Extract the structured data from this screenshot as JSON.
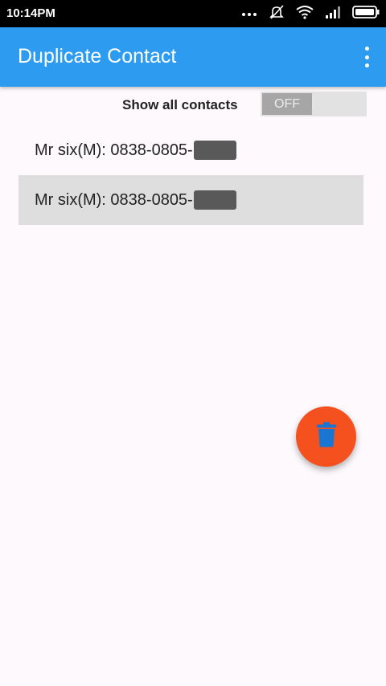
{
  "status_bar": {
    "time": "10:14PM",
    "icons": [
      "dots-icon",
      "muted-icon",
      "wifi-icon",
      "signal-icon",
      "battery-icon"
    ]
  },
  "app_bar": {
    "title": "Duplicate Contact",
    "menu_icon": "overflow-menu-icon",
    "color": "#2d9cf0"
  },
  "filter": {
    "label": "Show all contacts",
    "toggle_text": "OFF",
    "toggle_on": false
  },
  "contacts": [
    {
      "text": "Mr six(M): 0838-0805-",
      "selected": false
    },
    {
      "text": "Mr six(M): 0838-0805-",
      "selected": true
    }
  ],
  "fab": {
    "icon": "trash-icon",
    "color": "#f4511e"
  }
}
